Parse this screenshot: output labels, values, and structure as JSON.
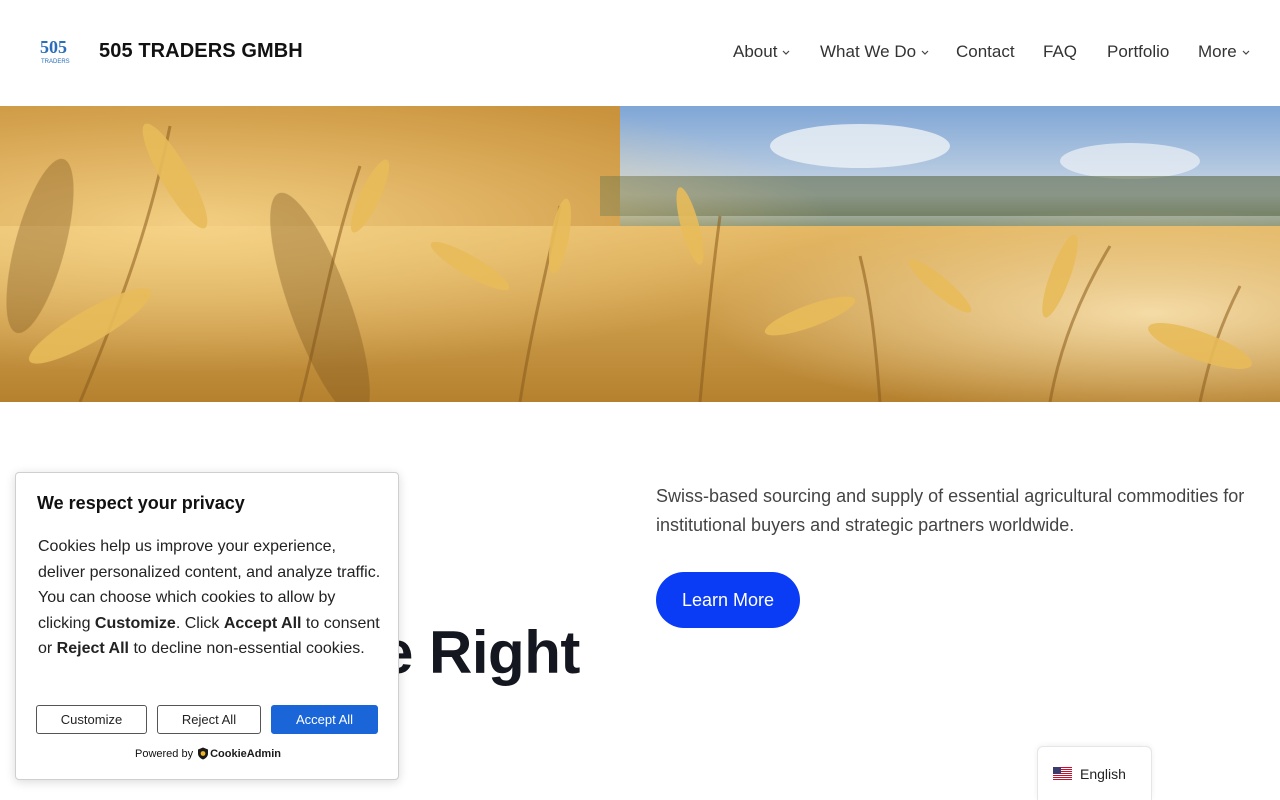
{
  "header": {
    "logo_text": "505",
    "logo_subtext": "TRADERS",
    "brand": "505 TRADERS GMBH"
  },
  "nav": {
    "items": [
      {
        "label": "About",
        "has_dropdown": true
      },
      {
        "label": "What We Do",
        "has_dropdown": true
      },
      {
        "label": "Contact",
        "has_dropdown": false
      },
      {
        "label": "FAQ",
        "has_dropdown": false
      },
      {
        "label": "Portfolio",
        "has_dropdown": false
      },
      {
        "label": "More",
        "has_dropdown": true
      }
    ]
  },
  "hero": {
    "heading_visible": "e Right",
    "description": "Swiss-based sourcing and supply of essential agricultural commodities for institutional buyers and strategic partners worldwide.",
    "cta_label": "Learn More"
  },
  "cookie_banner": {
    "title": "We respect your privacy",
    "text_1": "Cookies help us improve your experience, deliver personalized content, and analyze traffic. You can choose which cookies to allow by clicking ",
    "text_bold_1": "Customize",
    "text_2": ". Click ",
    "text_bold_2": "Accept All",
    "text_3": " to consent or ",
    "text_bold_3": "Reject All",
    "text_4": " to decline non-essential cookies.",
    "customize_label": "Customize",
    "reject_label": "Reject All",
    "accept_label": "Accept All",
    "powered_by": "Powered by",
    "powered_brand": "CookieAdmin"
  },
  "language": {
    "selected": "English",
    "flag_icon": "us-flag-icon"
  },
  "colors": {
    "cta_blue": "#0a3cf5",
    "accept_blue": "#1a66d9",
    "wheat_gold": "#d9a441"
  }
}
